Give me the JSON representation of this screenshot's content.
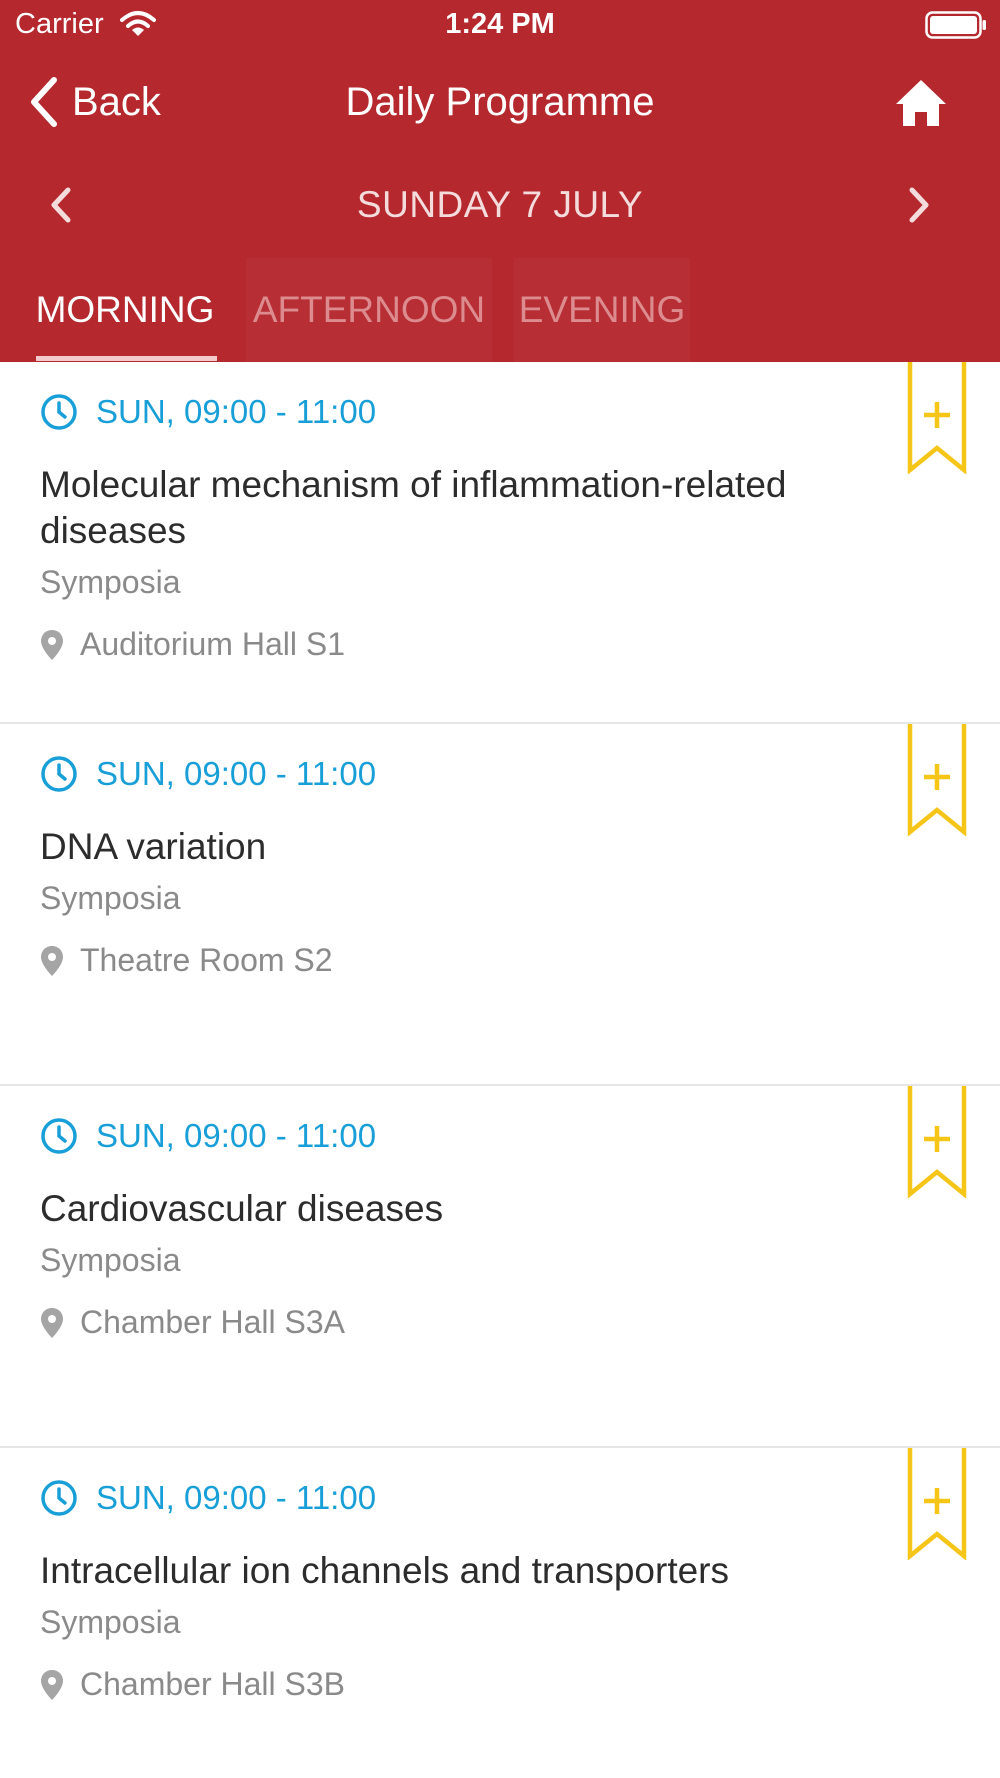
{
  "status_bar": {
    "carrier": "Carrier",
    "time": "1:24 PM"
  },
  "nav": {
    "back_label": "Back",
    "title": "Daily Programme"
  },
  "date_nav": {
    "label": "SUNDAY 7 JULY"
  },
  "tabs": [
    {
      "label": "MORNING",
      "active": true
    },
    {
      "label": "AFTERNOON",
      "active": false
    },
    {
      "label": "EVENING",
      "active": false
    }
  ],
  "sessions": [
    {
      "time": "SUN, 09:00 - 11:00",
      "title": "Molecular mechanism of inflammation-related diseases",
      "type": "Symposia",
      "location": "Auditorium Hall S1"
    },
    {
      "time": "SUN, 09:00 - 11:00",
      "title": "DNA variation",
      "type": "Symposia",
      "location": "Theatre Room S2"
    },
    {
      "time": "SUN, 09:00 - 11:00",
      "title": "Cardiovascular diseases",
      "type": "Symposia",
      "location": "Chamber Hall S3A"
    },
    {
      "time": "SUN, 09:00 - 11:00",
      "title": "Intracellular ion channels and transporters",
      "type": "Symposia",
      "location": "Chamber Hall S3B"
    }
  ],
  "colors": {
    "header_red": "#b5282e",
    "time_blue": "#199fd8",
    "bookmark_yellow": "#f5c518",
    "secondary_text": "#8a8a8a"
  }
}
